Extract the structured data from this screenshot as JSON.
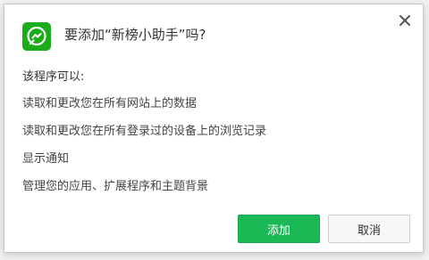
{
  "dialog": {
    "title": "要添加“新榜小助手”吗?",
    "close_icon": "close-icon",
    "app_icon": "extension-chat-icon",
    "permissions_header": "该程序可以:",
    "permissions": [
      "读取和更改您在所有网站上的数据",
      "读取和更改您在所有登录过的设备上的浏览记录",
      "显示通知",
      "管理您的应用、扩展程序和主题背景"
    ],
    "buttons": {
      "add_label": "添加",
      "cancel_label": "取消"
    }
  },
  "colors": {
    "accent": "#1ab955",
    "app_icon_bg": "#1aad19"
  }
}
